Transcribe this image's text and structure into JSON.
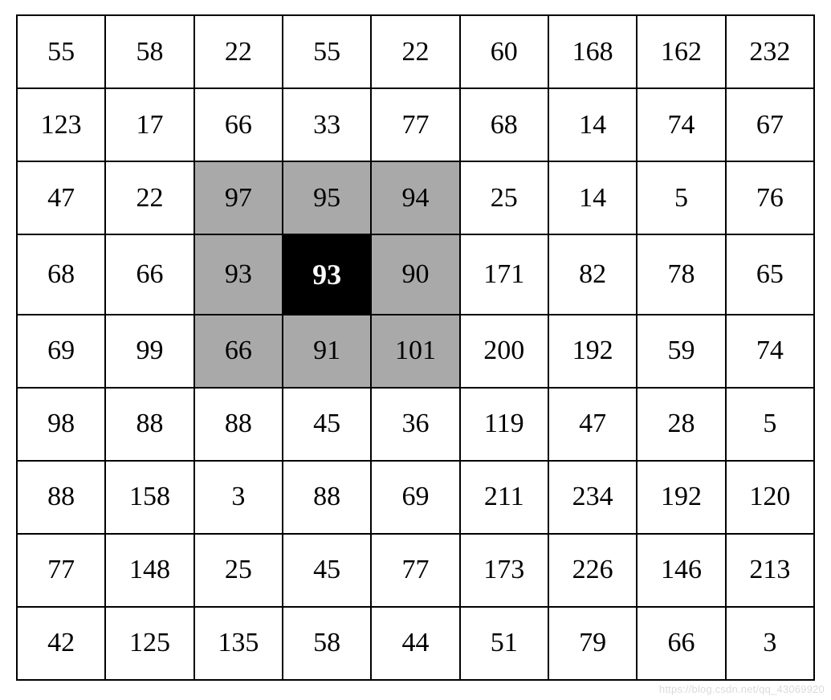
{
  "grid": {
    "rows": 9,
    "cols": 9,
    "values": [
      [
        55,
        58,
        22,
        55,
        22,
        60,
        168,
        162,
        232
      ],
      [
        123,
        17,
        66,
        33,
        77,
        68,
        14,
        74,
        67
      ],
      [
        47,
        22,
        97,
        95,
        94,
        25,
        14,
        5,
        76
      ],
      [
        68,
        66,
        93,
        93,
        90,
        171,
        82,
        78,
        65
      ],
      [
        69,
        99,
        66,
        91,
        101,
        200,
        192,
        59,
        74
      ],
      [
        98,
        88,
        88,
        45,
        36,
        119,
        47,
        28,
        5
      ],
      [
        88,
        158,
        3,
        88,
        69,
        211,
        234,
        192,
        120
      ],
      [
        77,
        148,
        25,
        45,
        77,
        173,
        226,
        146,
        213
      ],
      [
        42,
        125,
        135,
        58,
        44,
        51,
        79,
        66,
        3
      ]
    ],
    "highlight": {
      "shaded_cells": [
        [
          2,
          2
        ],
        [
          2,
          3
        ],
        [
          2,
          4
        ],
        [
          3,
          2
        ],
        [
          3,
          4
        ],
        [
          4,
          2
        ],
        [
          4,
          3
        ],
        [
          4,
          4
        ]
      ],
      "center_cell": [
        3,
        3
      ]
    }
  },
  "watermark": "https://blog.csdn.net/qq_43069920"
}
